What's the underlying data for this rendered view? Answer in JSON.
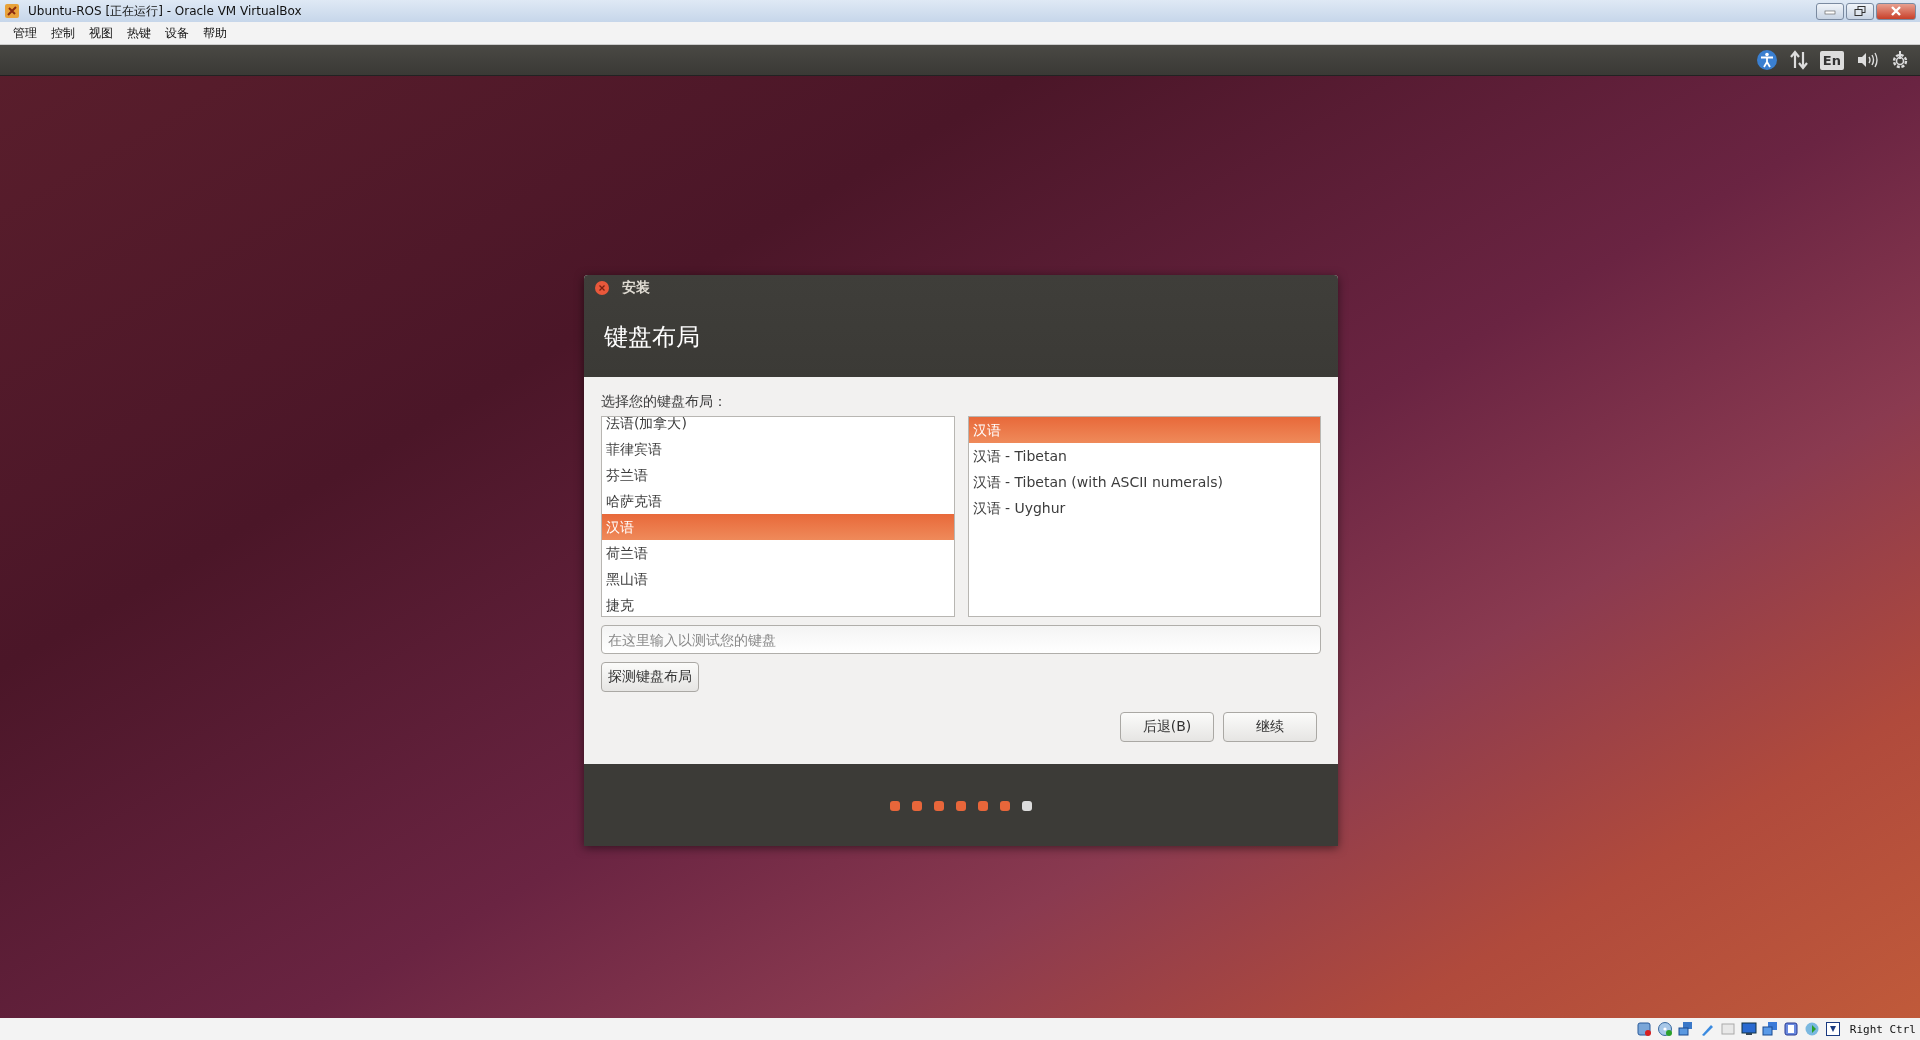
{
  "window": {
    "title": "Ubuntu-ROS [正在运行] - Oracle VM VirtualBox"
  },
  "menu": [
    "管理",
    "控制",
    "视图",
    "热键",
    "设备",
    "帮助"
  ],
  "panel": {
    "keyboard_indicator": "En"
  },
  "dialog": {
    "title": "安装",
    "heading": "键盘布局",
    "prompt": "选择您的键盘布局：",
    "layouts": [
      {
        "label": "法语(加拿大)",
        "selected": false
      },
      {
        "label": "菲律宾语",
        "selected": false
      },
      {
        "label": "芬兰语",
        "selected": false
      },
      {
        "label": "哈萨克语",
        "selected": false
      },
      {
        "label": "汉语",
        "selected": true
      },
      {
        "label": "荷兰语",
        "selected": false
      },
      {
        "label": "黑山语",
        "selected": false
      },
      {
        "label": "捷克",
        "selected": false
      }
    ],
    "variants": [
      {
        "label": "汉语",
        "selected": true
      },
      {
        "label": "汉语 - Tibetan",
        "selected": false
      },
      {
        "label": "汉语 - Tibetan (with ASCII numerals)",
        "selected": false
      },
      {
        "label": "汉语 - Uyghur",
        "selected": false
      }
    ],
    "test_field": {
      "placeholder": "在这里输入以测试您的键盘"
    },
    "detect_button": "探测键盘布局",
    "buttons": [
      "后退(B)",
      "继续"
    ],
    "progress": [
      {
        "done": true
      },
      {
        "done": true
      },
      {
        "done": true
      },
      {
        "done": true
      },
      {
        "done": true
      },
      {
        "done": true
      },
      {
        "done": false
      }
    ]
  },
  "status_bar": {
    "host_key": "Right Ctrl"
  }
}
